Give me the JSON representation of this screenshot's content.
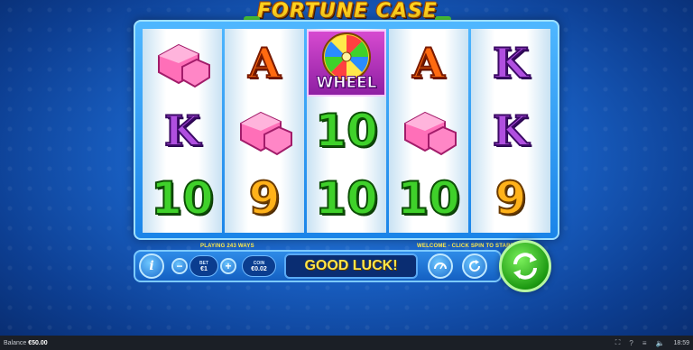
{
  "game": {
    "title": "FORTUNE CASE"
  },
  "reels": [
    [
      "gem",
      "K",
      "10"
    ],
    [
      "A",
      "gem",
      "9"
    ],
    [
      "wheel",
      "10",
      "10"
    ],
    [
      "A",
      "gem",
      "10"
    ],
    [
      "K",
      "K",
      "9"
    ]
  ],
  "symbols": {
    "wheel_label": "WHEEL"
  },
  "info": {
    "ways": "PLAYING 243 WAYS",
    "welcome": "WELCOME - CLICK SPIN TO START"
  },
  "controls": {
    "info_label": "i",
    "bet_minus": "−",
    "bet_plus": "+",
    "bet_label": "BET",
    "bet_value": "€1",
    "coin_label": "COIN",
    "coin_value": "€0.02",
    "message": "GOOD LUCK!"
  },
  "status_bar": {
    "balance_label": "Balance",
    "balance_value": "€50.00",
    "time": "18:59"
  },
  "colors": {
    "accent_yellow": "#ffe54a",
    "spin_green": "#1d9a12",
    "panel_blue": "#1460c2"
  }
}
